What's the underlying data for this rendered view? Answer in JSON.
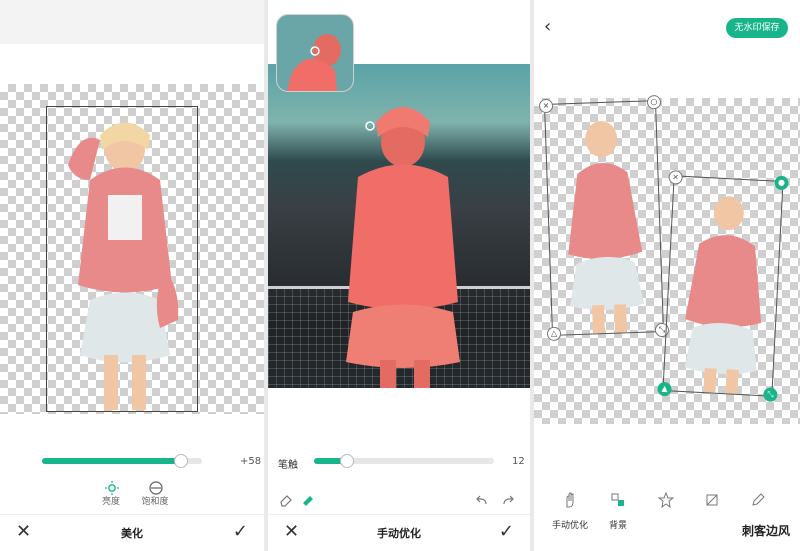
{
  "panel1": {
    "slider_value": "+58",
    "slider_level": 0.86,
    "tools": [
      {
        "label": "亮度",
        "icon": "sun-icon"
      },
      {
        "label": "饱和度",
        "icon": "saturation-icon"
      }
    ],
    "bottom": {
      "title": "美化"
    }
  },
  "panel2": {
    "brush_label": "笔触",
    "brush_value": "12",
    "brush_level": 0.18,
    "bottom": {
      "title": "手动优化"
    }
  },
  "panel3": {
    "save_label": "无水印保存",
    "tools": [
      {
        "label": "手动优化",
        "icon": "hand-icon"
      },
      {
        "label": "背景",
        "icon": "background-icon"
      },
      {
        "label": "",
        "icon": "sticker-icon"
      },
      {
        "label": "",
        "icon": "crop-icon"
      },
      {
        "label": "",
        "icon": "edit-icon"
      }
    ],
    "watermark": "刺客边风"
  },
  "colors": {
    "accent": "#19b58a",
    "checker": "#cfcfcf",
    "jacket": "#e06a6a",
    "photo_top": "#5aa3a7"
  }
}
